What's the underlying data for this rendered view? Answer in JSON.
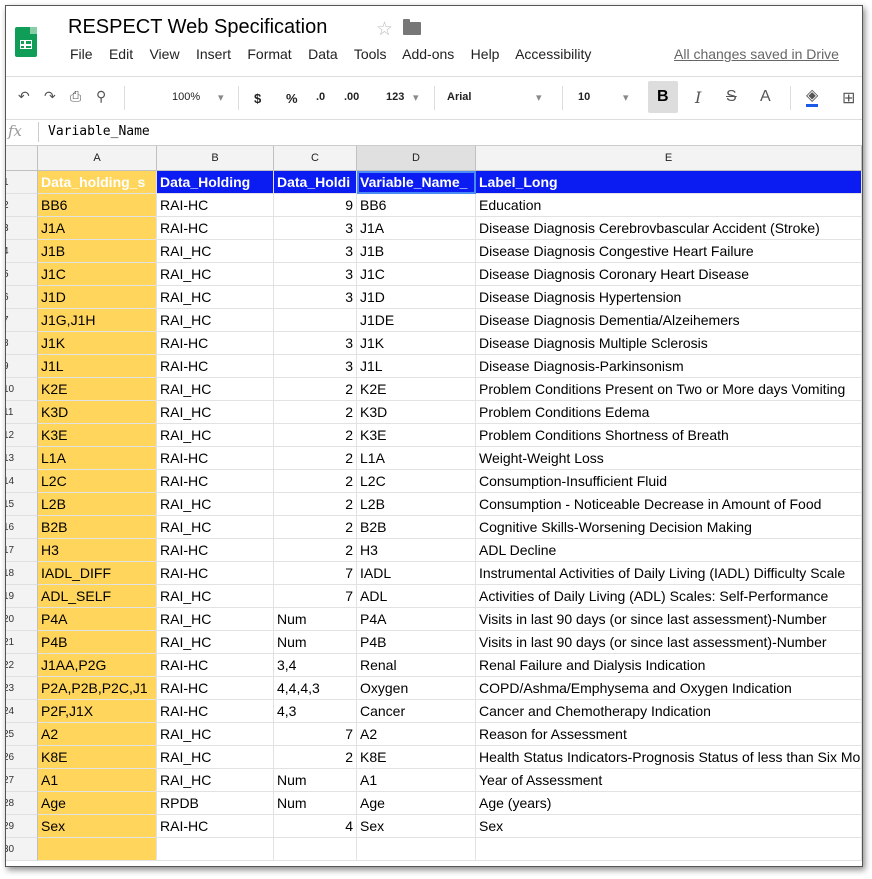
{
  "app": {
    "title": "RESPECT Web Specification",
    "menu": [
      "File",
      "Edit",
      "View",
      "Insert",
      "Format",
      "Data",
      "Tools",
      "Add-ons",
      "Help",
      "Accessibility"
    ],
    "save_status": "All changes saved in Drive"
  },
  "toolbar": {
    "zoom": "100%",
    "currency": "$",
    "percent": "%",
    "decimal_decrease": ".0",
    "decimal_increase": ".00",
    "number_format": "123",
    "font": "Arial",
    "font_size": "10",
    "bold": "B",
    "italic": "I",
    "strike": "S",
    "text_color": "A"
  },
  "formula_bar": {
    "fx": "fx",
    "value": "Variable_Name"
  },
  "columns": [
    "A",
    "B",
    "C",
    "D",
    "E"
  ],
  "colors": {
    "header_blue": "#0b1cf3",
    "column_a_yellow": "#ffd55c",
    "selection_blue": "#4a8af4"
  },
  "rows": [
    [
      "Data_holding_s",
      "Data_Holding",
      "Data_Holdi",
      "Variable_Name_",
      "Label_Long"
    ],
    [
      "BB6",
      "RAI-HC",
      "9",
      "BB6",
      "Education"
    ],
    [
      "J1A",
      "RAI-HC",
      "3",
      "J1A",
      "Disease Diagnosis Cerebrovbascular Accident (Stroke)"
    ],
    [
      "J1B",
      "RAI_HC",
      "3",
      "J1B",
      "Disease Diagnosis Congestive Heart Failure"
    ],
    [
      "J1C",
      "RAI_HC",
      "3",
      "J1C",
      "Disease Diagnosis Coronary Heart Disease"
    ],
    [
      "J1D",
      "RAI_HC",
      "3",
      "J1D",
      "Disease Diagnosis Hypertension"
    ],
    [
      "J1G,J1H",
      "RAI_HC",
      "",
      "J1DE",
      "Disease Diagnosis Dementia/Alzeihemers"
    ],
    [
      "J1K",
      "RAI-HC",
      "3",
      "J1K",
      "Disease Diagnosis Multiple Sclerosis"
    ],
    [
      "J1L",
      "RAI-HC",
      "3",
      "J1L",
      "Disease Diagnosis-Parkinsonism"
    ],
    [
      "K2E",
      "RAI_HC",
      "2",
      "K2E",
      "Problem Conditions Present on Two or More days Vomiting"
    ],
    [
      "K3D",
      "RAI_HC",
      "2",
      "K3D",
      "Problem Conditions Edema"
    ],
    [
      "K3E",
      "RAI_HC",
      "2",
      "K3E",
      "Problem  Conditions Shortness of Breath"
    ],
    [
      "L1A",
      "RAI-HC",
      "2",
      "L1A",
      "Weight-Weight Loss"
    ],
    [
      "L2C",
      "RAI-HC",
      "2",
      "L2C",
      "Consumption-Insufficient Fluid"
    ],
    [
      "L2B",
      "RAI_HC",
      "2",
      "L2B",
      "Consumption - Noticeable Decrease in Amount of Food"
    ],
    [
      "B2B",
      "RAI_HC",
      "2",
      "B2B",
      "Cognitive Skills-Worsening Decision Making"
    ],
    [
      "H3",
      "RAI-HC",
      "2",
      "H3",
      "ADL Decline"
    ],
    [
      "IADL_DIFF",
      "RAI-HC",
      "7",
      "IADL",
      "Instrumental Activities of Daily Living (IADL) Difficulty Scale"
    ],
    [
      "ADL_SELF",
      "RAI_HC",
      "7",
      "ADL",
      "Activities of Daily Living (ADL) Scales: Self-Performance"
    ],
    [
      "P4A",
      "RAI_HC",
      "Num",
      "P4A",
      "Visits in last 90 days (or since last assessment)-Number"
    ],
    [
      "P4B",
      "RAI_HC",
      "Num",
      "P4B",
      "Visits in last 90 days (or since last assessment)-Number"
    ],
    [
      "J1AA,P2G",
      "RAI-HC",
      "3,4",
      "Renal",
      "Renal Failure and Dialysis Indication"
    ],
    [
      "P2A,P2B,P2C,J1",
      "RAI-HC",
      "4,4,4,3",
      "Oxygen",
      "COPD/Ashma/Emphysema and Oxygen Indication"
    ],
    [
      "P2F,J1X",
      "RAI-HC",
      "4,3",
      "Cancer",
      "Cancer and Chemotherapy Indication"
    ],
    [
      "A2",
      "RAI_HC",
      "7",
      "A2",
      "Reason for Assessment"
    ],
    [
      "K8E",
      "RAI_HC",
      "2",
      "K8E",
      "Health Status Indicators-Prognosis Status of less than Six Months"
    ],
    [
      "A1",
      "RAI_HC",
      "Num",
      "A1",
      "Year of Assessment"
    ],
    [
      "Age",
      "RPDB",
      "Num",
      "Age",
      "Age (years)"
    ],
    [
      "Sex",
      "RAI-HC",
      "4",
      "Sex",
      "Sex"
    ],
    [
      "",
      "",
      "",
      "",
      ""
    ]
  ]
}
